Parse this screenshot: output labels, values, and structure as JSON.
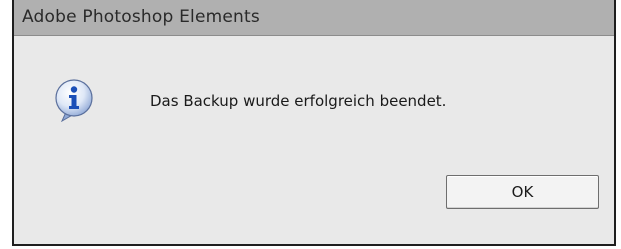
{
  "window": {
    "title": "Adobe Photoshop Elements"
  },
  "dialog": {
    "icon": "info-icon",
    "message": "Das Backup wurde erfolgreich beendet.",
    "ok_label": "OK"
  },
  "colors": {
    "titlebar": "#b0b0b0",
    "dialog_bg": "#e9e9e9",
    "icon_blue": "#1b4fb8"
  }
}
